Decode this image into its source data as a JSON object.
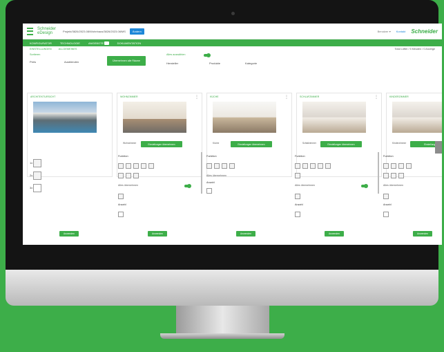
{
  "header": {
    "logo_line1": "Schneider",
    "logo_line2": "eDesign",
    "project": "Projekt/3826/2023.08/Wohnhaus/3826/2023.08/MS",
    "project_btn": "Ändern",
    "user": "Benutzer ▾",
    "link": "Kontakt",
    "brand": "Schneider",
    "brand_sub": "Electric"
  },
  "nav": {
    "tabs": [
      "KONFIGURATOR",
      "TECHNOLOGIE",
      "ANGEBOTE",
      "DOKUMENTATION"
    ],
    "badge": "3"
  },
  "subtabs": {
    "left": [
      "EINSTELLUNGEN",
      "ALLGEMEINES"
    ],
    "right": "Total Lüfter / 5 Minuten / 0 Anzeige"
  },
  "controls": {
    "label1": "Sortieren",
    "sort_value": "Preis",
    "hide_text": "Ausblenden",
    "toggle_label": "Alles auswählen",
    "opt1": "Hersteller",
    "opt2": "Produkte",
    "opt3": "Kategorie",
    "apply_all": "Übernehmen alle Räume"
  },
  "cards": [
    {
      "title": "ARCHITEKTURSICHT",
      "kind": "house"
    },
    {
      "title": "WOHNZIMMER",
      "kind": "living",
      "room": "Wohnzimmer",
      "btn": "Einstellungen übernehmen"
    },
    {
      "title": "KÜCHE",
      "kind": "kitchen",
      "room": "Küche",
      "btn": "Einstellungen übernehmen"
    },
    {
      "title": "SCHLAFZIMMER",
      "kind": "bedroom",
      "room": "Schlafzimmer",
      "btn": "Einstellungen übernehmen"
    },
    {
      "title": "KINDERZIMMER",
      "kind": "bedroom",
      "room": "Kinderzimmer",
      "btn": "Einstellungen"
    }
  ],
  "config": {
    "heading": "Funktion",
    "heading2": "Anzahl",
    "toggle_label": "Alles übernehmen",
    "apply": "Anwenden",
    "items": [
      "1x",
      "2x",
      "3x"
    ]
  },
  "colors": {
    "accent": "#3dae49",
    "link": "#1e87d8",
    "frame": "#141414"
  }
}
